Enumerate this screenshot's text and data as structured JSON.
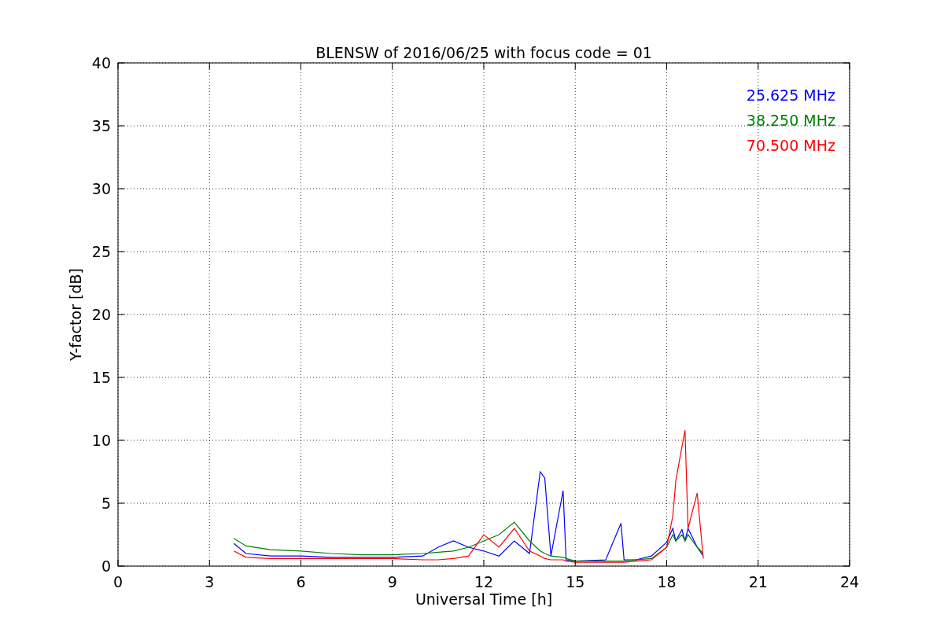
{
  "chart_data": {
    "type": "line",
    "title": "BLENSW of 2016/06/25 with focus code = 01",
    "xlabel": "Universal Time [h]",
    "ylabel": "Y-factor [dB]",
    "x": [
      3.8,
      4.2,
      5,
      6,
      7,
      8,
      9,
      10,
      10.5,
      11,
      11.5,
      12,
      12.5,
      13,
      13.5,
      13.85,
      14,
      14.2,
      14.6,
      14.7,
      15,
      16,
      16.5,
      16.6,
      17,
      17.5,
      18,
      18.2,
      18.3,
      18.5,
      18.6,
      18.7,
      19,
      19.2
    ],
    "series": [
      {
        "name": "25.625 MHz",
        "color": "#0000ff",
        "values": [
          1.8,
          1.0,
          0.8,
          0.8,
          0.7,
          0.7,
          0.7,
          0.8,
          1.5,
          2.0,
          1.5,
          1.2,
          0.8,
          2.0,
          1.0,
          7.5,
          7.0,
          0.8,
          6.0,
          0.5,
          0.4,
          0.5,
          3.4,
          0.5,
          0.5,
          0.8,
          1.9,
          3.0,
          2.0,
          2.9,
          2.0,
          3.0,
          1.5,
          0.8
        ]
      },
      {
        "name": "38.250 MHz",
        "color": "#008000",
        "values": [
          2.2,
          1.6,
          1.3,
          1.2,
          1.0,
          0.9,
          0.9,
          1.0,
          1.1,
          1.2,
          1.5,
          2.0,
          2.5,
          3.5,
          2.0,
          1.2,
          1.0,
          0.8,
          0.7,
          0.6,
          0.4,
          0.4,
          0.4,
          0.4,
          0.5,
          0.6,
          1.5,
          2.5,
          2.0,
          2.5,
          2.0,
          2.5,
          1.5,
          1.0
        ]
      },
      {
        "name": "70.500 MHz",
        "color": "#ff0000",
        "values": [
          1.2,
          0.7,
          0.6,
          0.6,
          0.6,
          0.6,
          0.6,
          0.5,
          0.5,
          0.6,
          0.8,
          2.5,
          1.5,
          3.0,
          1.2,
          0.8,
          0.6,
          0.5,
          0.5,
          0.4,
          0.3,
          0.3,
          0.3,
          0.3,
          0.4,
          0.5,
          1.5,
          4.0,
          6.8,
          9.5,
          10.8,
          3.0,
          5.8,
          0.6
        ]
      }
    ],
    "xlim": [
      0,
      24
    ],
    "ylim": [
      0,
      40
    ],
    "xticks": [
      0,
      3,
      6,
      9,
      12,
      15,
      18,
      21,
      24
    ],
    "yticks": [
      0,
      5,
      10,
      15,
      20,
      25,
      30,
      35,
      40
    ],
    "grid": true
  }
}
